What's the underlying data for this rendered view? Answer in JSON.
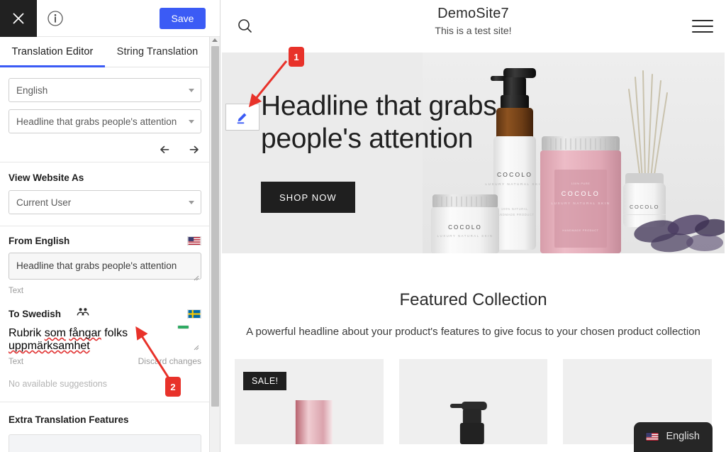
{
  "sidebar": {
    "topbar": {
      "close_icon": "close-icon",
      "info_icon": "info-icon",
      "save_label": "Save"
    },
    "tabs": [
      {
        "label": "Translation Editor",
        "active": true
      },
      {
        "label": "String Translation",
        "active": false
      }
    ],
    "language_select": {
      "value": "English"
    },
    "string_select": {
      "value": "Headline that grabs people's attention"
    },
    "history": {
      "undo_icon": "undo-icon",
      "redo_icon": "redo-icon"
    },
    "view_website_as": {
      "label": "View Website As",
      "select_value": "Current User"
    },
    "from": {
      "label": "From English",
      "flag": "us-flag-icon",
      "value": "Headline that grabs people's attention",
      "type_label": "Text"
    },
    "to": {
      "label": "To Swedish",
      "people_icon": "people-icon",
      "flag": "se-flag-icon",
      "value": "Rubrik som fångar folks uppmärksamhet",
      "value_words": [
        "Rubrik",
        "som",
        "fångar",
        "folks",
        "uppmärksamhet"
      ],
      "misspelled": [
        "som",
        "fångar",
        "uppmärksamhet"
      ],
      "type_label": "Text",
      "discard_label": "Discard changes",
      "suggestions_label": "No available suggestions"
    },
    "extra": {
      "label": "Extra Translation Features"
    },
    "scrollbar": {
      "name": "sidebar-scrollbar"
    }
  },
  "site": {
    "search_icon": "search-icon",
    "menu_icon": "hamburger-menu-icon",
    "title": "DemoSite7",
    "tagline": "This is a test site!",
    "hero": {
      "headline": "Headline that grabs people's attention",
      "cta_label": "SHOP NOW",
      "edit_icon": "pencil-edit-icon",
      "image_alt": "cocolo-products-photo",
      "bg_color": "#ebebeb"
    },
    "featured": {
      "title": "Featured Collection",
      "subtitle": "A powerful headline about your product's features to give focus to your chosen product collection",
      "products": [
        {
          "badge": "SALE!"
        },
        {
          "badge": ""
        },
        {
          "badge": ""
        }
      ]
    },
    "language_switcher": {
      "flag": "us-flag-icon",
      "label": "English"
    }
  },
  "annotations": [
    {
      "number": "1",
      "color": "#e8322a"
    },
    {
      "number": "2",
      "color": "#e8322a"
    }
  ],
  "colors": {
    "accent_blue": "#3b5bf5",
    "annotation_red": "#e8322a",
    "dark": "#1f1f1f",
    "hero_bg": "#ebebeb"
  }
}
